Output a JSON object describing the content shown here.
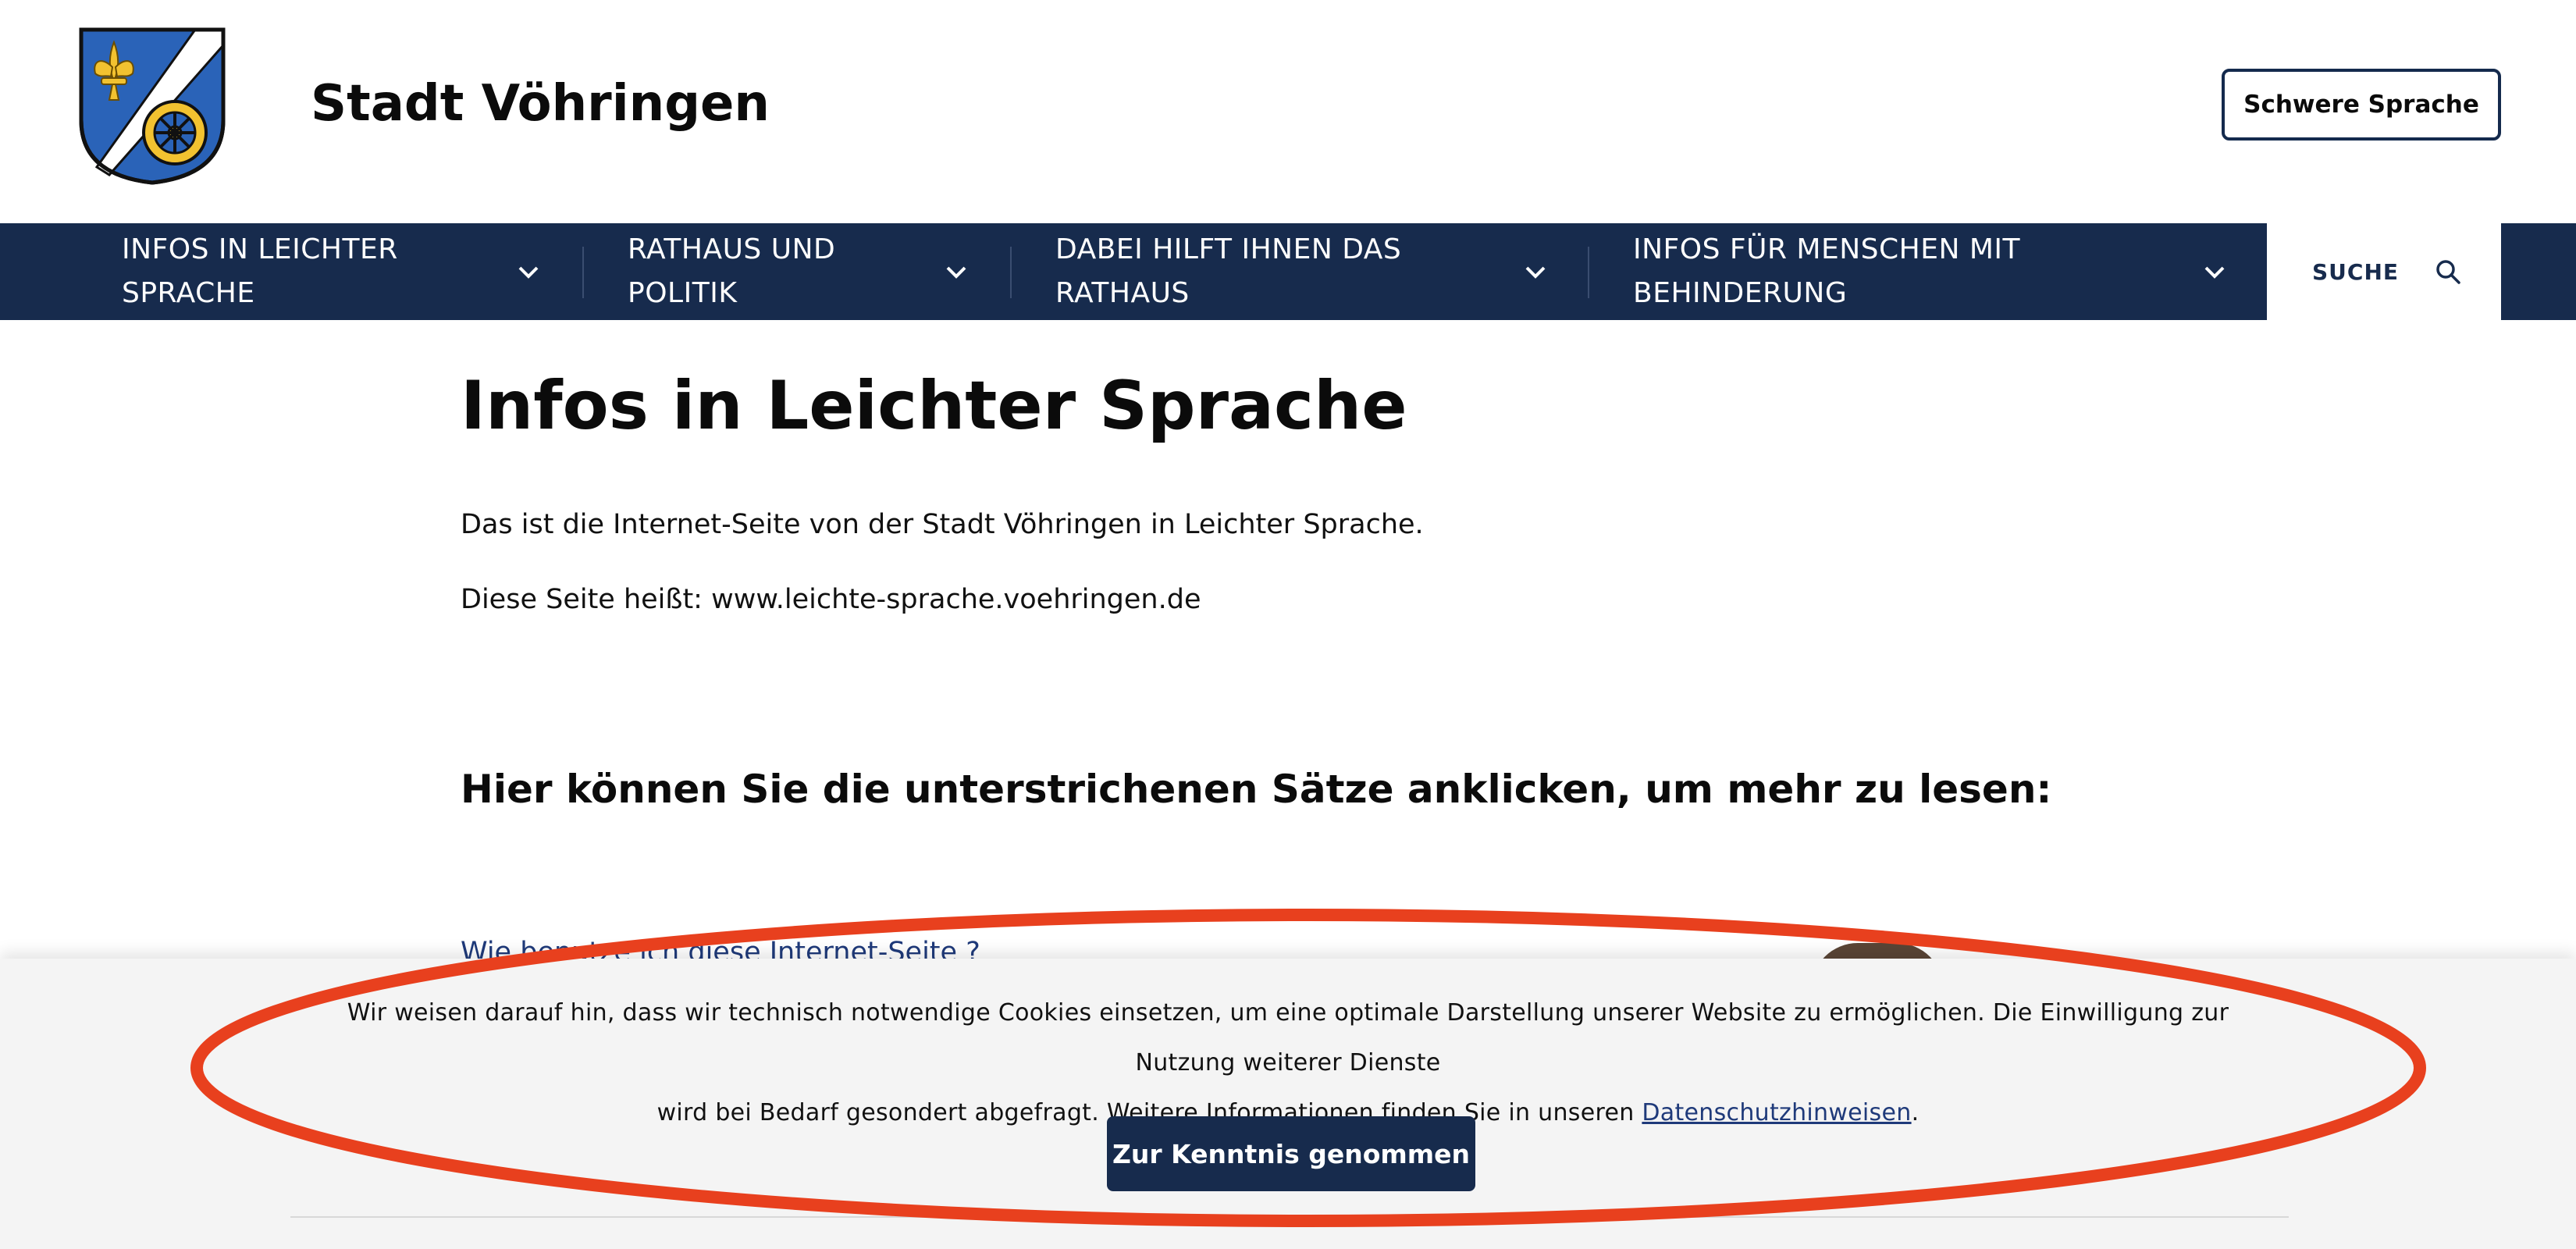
{
  "header": {
    "site_title": "Stadt Vöhringen",
    "lang_button": "Schwere Sprache"
  },
  "nav": {
    "items": [
      {
        "line1": "INFOS IN LEICHTER",
        "line2": "SPRACHE"
      },
      {
        "line1": "RATHAUS UND",
        "line2": "POLITIK"
      },
      {
        "line1": "DABEI HILFT IHNEN DAS",
        "line2": "RATHAUS"
      },
      {
        "line1": "INFOS FÜR MENSCHEN MIT",
        "line2": "BEHINDERUNG"
      }
    ],
    "search_label": "SUCHE"
  },
  "content": {
    "title": "Infos in Leichter Sprache",
    "paragraph1": "Das ist die Internet-Seite von der Stadt Vöhringen in Leichter Sprache.",
    "paragraph2": "Diese Seite heißt: www.leichte-sprache.voehringen.de",
    "subheading": "Hier können Sie die unterstrichenen Sätze anklicken, um mehr zu lesen:",
    "partial_link": "Wie benutze ich diese Internet-Seite ?"
  },
  "cookie_banner": {
    "text_line1": "Wir weisen darauf hin, dass wir technisch notwendige Cookies einsetzen, um eine optimale Darstellung unserer Website zu ermöglichen. Die Einwilligung zur Nutzung weiterer Dienste",
    "text_line2_prefix": "wird bei Bedarf gesondert abgefragt. Weitere Informationen finden Sie in unseren ",
    "link_label": "Datenschutzhinweisen",
    "text_line2_suffix": ".",
    "button_label": "Zur Kenntnis genommen"
  },
  "colors": {
    "nav_bg": "#172b4d",
    "accent_link": "#1f3a7a",
    "annotation_red": "#e8401e",
    "coat_blue": "#2a63b8",
    "coat_gold": "#f2c230"
  },
  "icons": [
    "coat-of-arms-logo",
    "chevron-down-icon",
    "search-icon"
  ]
}
